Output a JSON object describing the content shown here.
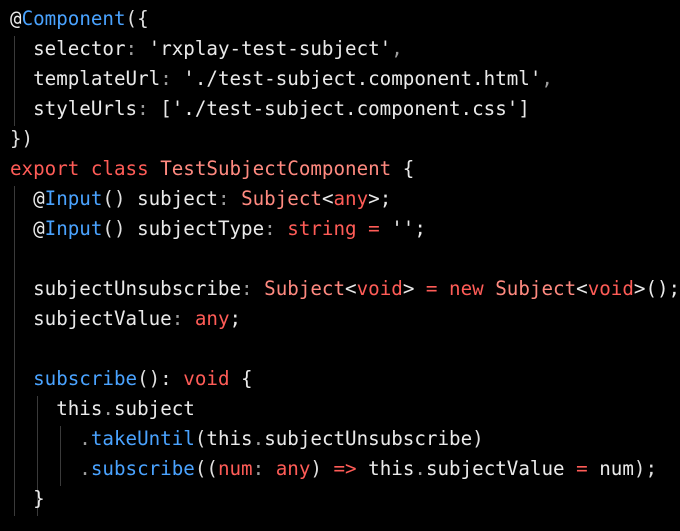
{
  "editor": {
    "background": "#000000",
    "token_colors": {
      "default": "#eaeaea",
      "punctuation": "#9e9e9e",
      "keyword": "#ff5c57",
      "function": "#4aa3ff",
      "type": "#ff8a80"
    },
    "lines": [
      {
        "tokens": [
          {
            "t": "@",
            "c": "default"
          },
          {
            "t": "Component",
            "c": "func"
          },
          {
            "t": "({",
            "c": "bracket"
          }
        ]
      },
      {
        "tokens": [
          {
            "t": "  selector",
            "c": "default"
          },
          {
            "t": ":",
            "c": "punct"
          },
          {
            "t": " 'rxplay-test-subject'",
            "c": "string"
          },
          {
            "t": ",",
            "c": "punct"
          }
        ]
      },
      {
        "tokens": [
          {
            "t": "  templateUrl",
            "c": "default"
          },
          {
            "t": ":",
            "c": "punct"
          },
          {
            "t": " './test-subject.component.html'",
            "c": "string"
          },
          {
            "t": ",",
            "c": "punct"
          }
        ]
      },
      {
        "tokens": [
          {
            "t": "  styleUrls",
            "c": "default"
          },
          {
            "t": ":",
            "c": "punct"
          },
          {
            "t": " ['./test-subject.component.css']",
            "c": "string"
          }
        ]
      },
      {
        "tokens": [
          {
            "t": "})",
            "c": "bracket"
          }
        ]
      },
      {
        "tokens": [
          {
            "t": "export",
            "c": "keyword"
          },
          {
            "t": " ",
            "c": "default"
          },
          {
            "t": "class",
            "c": "keyword"
          },
          {
            "t": " TestSubjectComponent",
            "c": "type"
          },
          {
            "t": " {",
            "c": "default"
          }
        ]
      },
      {
        "tokens": [
          {
            "t": "  @",
            "c": "default"
          },
          {
            "t": "Input",
            "c": "func"
          },
          {
            "t": "()",
            "c": "bracket"
          },
          {
            "t": " subject",
            "c": "default"
          },
          {
            "t": ":",
            "c": "punct"
          },
          {
            "t": " Subject",
            "c": "type"
          },
          {
            "t": "<",
            "c": "default"
          },
          {
            "t": "any",
            "c": "keyword"
          },
          {
            "t": ">;",
            "c": "default"
          }
        ]
      },
      {
        "tokens": [
          {
            "t": "  @",
            "c": "default"
          },
          {
            "t": "Input",
            "c": "func"
          },
          {
            "t": "()",
            "c": "bracket"
          },
          {
            "t": " subjectType",
            "c": "default"
          },
          {
            "t": ":",
            "c": "punct"
          },
          {
            "t": " string",
            "c": "keyword"
          },
          {
            "t": " =",
            "c": "keyword"
          },
          {
            "t": " ''",
            "c": "string"
          },
          {
            "t": ";",
            "c": "default"
          }
        ]
      },
      {
        "tokens": []
      },
      {
        "tokens": [
          {
            "t": "  subjectUnsubscribe",
            "c": "default"
          },
          {
            "t": ":",
            "c": "punct"
          },
          {
            "t": " Subject",
            "c": "type"
          },
          {
            "t": "<",
            "c": "default"
          },
          {
            "t": "void",
            "c": "keyword"
          },
          {
            "t": ">",
            "c": "default"
          },
          {
            "t": " =",
            "c": "keyword"
          },
          {
            "t": " new",
            "c": "keyword"
          },
          {
            "t": " Subject",
            "c": "type"
          },
          {
            "t": "<",
            "c": "default"
          },
          {
            "t": "void",
            "c": "keyword"
          },
          {
            "t": ">();",
            "c": "default"
          }
        ]
      },
      {
        "tokens": [
          {
            "t": "  subjectValue",
            "c": "default"
          },
          {
            "t": ":",
            "c": "punct"
          },
          {
            "t": " any",
            "c": "keyword"
          },
          {
            "t": ";",
            "c": "default"
          }
        ]
      },
      {
        "tokens": []
      },
      {
        "tokens": [
          {
            "t": "  subscribe",
            "c": "func"
          },
          {
            "t": "():",
            "c": "bracket"
          },
          {
            "t": " void",
            "c": "keyword"
          },
          {
            "t": " {",
            "c": "default"
          }
        ]
      },
      {
        "tokens": [
          {
            "t": "    this",
            "c": "default"
          },
          {
            "t": ".",
            "c": "punct"
          },
          {
            "t": "subject",
            "c": "default"
          }
        ]
      },
      {
        "tokens": [
          {
            "t": "      .",
            "c": "punct"
          },
          {
            "t": "takeUntil",
            "c": "func"
          },
          {
            "t": "(",
            "c": "bracket"
          },
          {
            "t": "this",
            "c": "default"
          },
          {
            "t": ".",
            "c": "punct"
          },
          {
            "t": "subjectUnsubscribe",
            "c": "default"
          },
          {
            "t": ")",
            "c": "bracket"
          }
        ]
      },
      {
        "tokens": [
          {
            "t": "      .",
            "c": "punct"
          },
          {
            "t": "subscribe",
            "c": "func"
          },
          {
            "t": "((",
            "c": "bracket"
          },
          {
            "t": "num",
            "c": "keyword"
          },
          {
            "t": ":",
            "c": "punct"
          },
          {
            "t": " any",
            "c": "keyword"
          },
          {
            "t": ")",
            "c": "bracket"
          },
          {
            "t": " =>",
            "c": "keyword"
          },
          {
            "t": " this",
            "c": "default"
          },
          {
            "t": ".",
            "c": "punct"
          },
          {
            "t": "subjectValue",
            "c": "default"
          },
          {
            "t": " =",
            "c": "keyword"
          },
          {
            "t": " num",
            "c": "default"
          },
          {
            "t": ");",
            "c": "bracket"
          }
        ]
      },
      {
        "tokens": [
          {
            "t": "  }",
            "c": "default"
          }
        ]
      }
    ]
  }
}
